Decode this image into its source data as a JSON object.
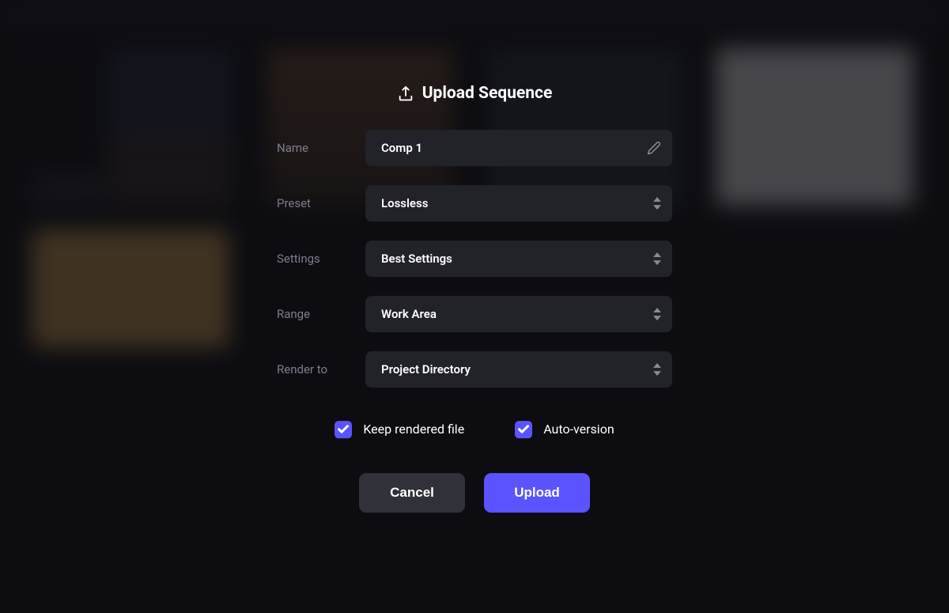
{
  "dialog": {
    "title": "Upload Sequence",
    "fields": {
      "name": {
        "label": "Name",
        "value": "Comp 1"
      },
      "preset": {
        "label": "Preset",
        "value": "Lossless"
      },
      "settings": {
        "label": "Settings",
        "value": "Best Settings"
      },
      "range": {
        "label": "Range",
        "value": "Work Area"
      },
      "render_to": {
        "label": "Render to",
        "value": "Project Directory"
      }
    },
    "checkboxes": {
      "keep_rendered": {
        "label": "Keep rendered file",
        "checked": true
      },
      "auto_version": {
        "label": "Auto-version",
        "checked": true
      }
    },
    "buttons": {
      "cancel": "Cancel",
      "upload": "Upload"
    }
  },
  "colors": {
    "accent": "#5b53ff"
  }
}
